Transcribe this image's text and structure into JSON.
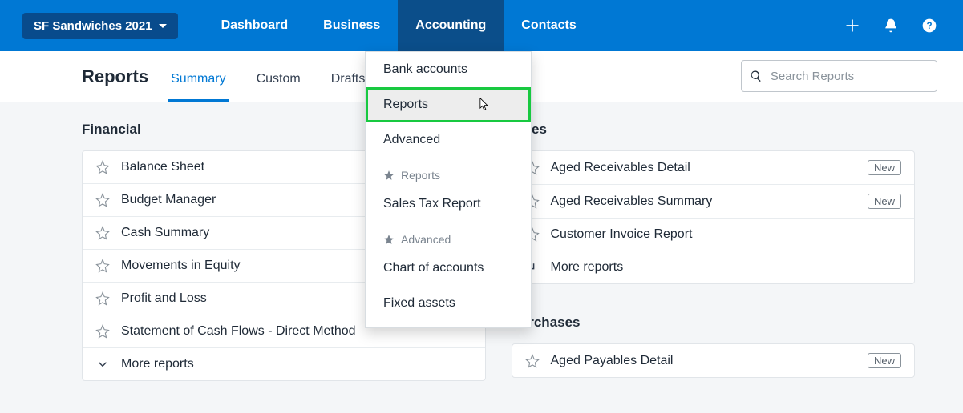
{
  "org_name": "SF Sandwiches 2021",
  "nav": {
    "dashboard": "Dashboard",
    "business": "Business",
    "accounting": "Accounting",
    "contacts": "Contacts"
  },
  "page_title": "Reports",
  "tabs": {
    "summary": "Summary",
    "custom": "Custom",
    "drafts": "Drafts"
  },
  "search": {
    "placeholder": "Search Reports"
  },
  "sections": {
    "financial": {
      "title": "Financial",
      "items": [
        {
          "label": "Balance Sheet"
        },
        {
          "label": "Budget Manager"
        },
        {
          "label": "Cash Summary"
        },
        {
          "label": "Movements in Equity"
        },
        {
          "label": "Profit and Loss"
        },
        {
          "label": "Statement of Cash Flows - Direct Method"
        }
      ],
      "more": "More reports"
    },
    "sales_title_fragment": "les",
    "sales": {
      "items": [
        {
          "label": "Aged Receivables Detail",
          "new": "New"
        },
        {
          "label": "Aged Receivables Summary",
          "new": "New"
        },
        {
          "label": "Customer Invoice Report"
        }
      ],
      "more": "More reports"
    },
    "purchases_title_fragment": "rchases",
    "purchases": {
      "items": [
        {
          "label": "Aged Payables Detail",
          "new": "New"
        }
      ]
    }
  },
  "dropdown": {
    "bank_accounts": "Bank accounts",
    "reports": "Reports",
    "advanced": "Advanced",
    "sec_reports": "Reports",
    "sales_tax": "Sales Tax Report",
    "sec_advanced": "Advanced",
    "chart_of_accounts": "Chart of accounts",
    "fixed_assets": "Fixed assets"
  }
}
